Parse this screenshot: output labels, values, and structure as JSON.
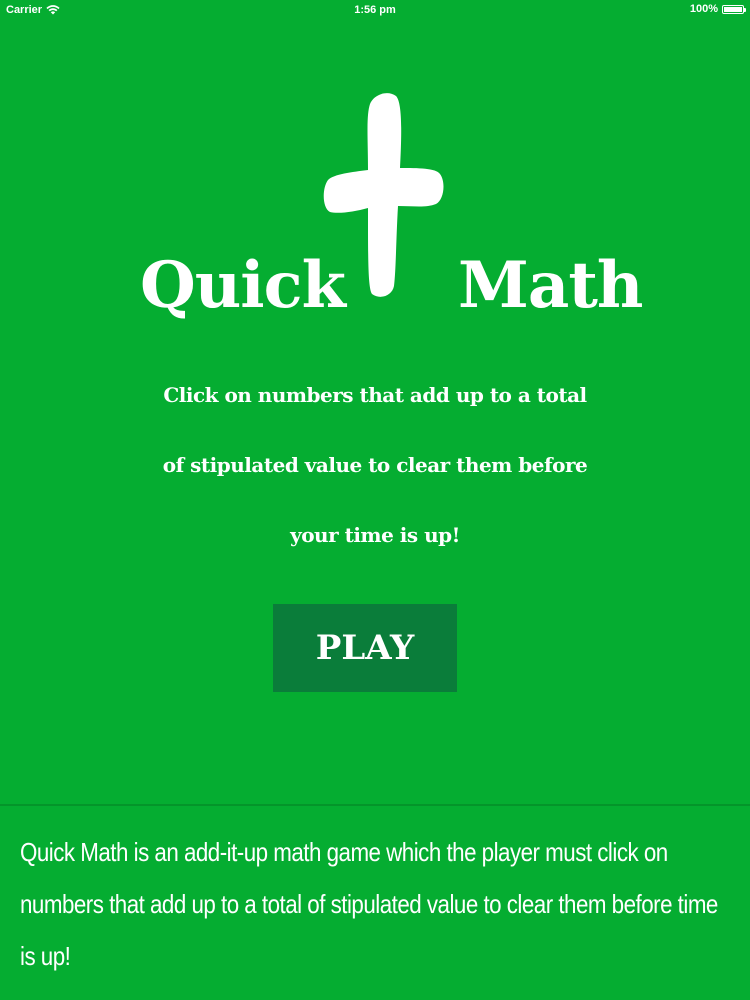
{
  "status_bar": {
    "carrier": "Carrier",
    "time": "1:56 pm",
    "battery": "100%",
    "battery_level": 1.0
  },
  "title": {
    "left_word": "Quick",
    "right_word": "Math",
    "symbol_icon": "plus-icon"
  },
  "instructions": "Click on numbers that add up to a total of stipulated value to clear them before your time is up!",
  "play_button": {
    "label": "PLAY"
  },
  "description": "Quick Math is an add-it-up math game which the player must click on numbers that add up to a total of stipulated value to clear them before time is up!",
  "colors": {
    "background": "#05ad31",
    "play_button": "#0a7d3a",
    "text": "#ffffff"
  }
}
